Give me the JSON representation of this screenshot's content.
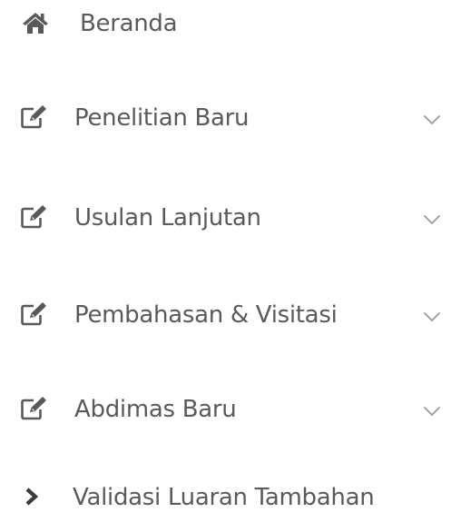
{
  "sidebar": {
    "text_color": "#5a5a5a",
    "icon_color": "#595959",
    "chevron_color": "#9a9a9a",
    "items": [
      {
        "label": "Beranda",
        "icon": "home-icon",
        "has_submenu": false
      },
      {
        "label": "Penelitian Baru",
        "icon": "edit-icon",
        "has_submenu": true
      },
      {
        "label": "Usulan Lanjutan",
        "icon": "edit-icon",
        "has_submenu": true
      },
      {
        "label": "Pembahasan & Visitasi",
        "icon": "edit-icon",
        "has_submenu": true
      },
      {
        "label": "Abdimas Baru",
        "icon": "edit-icon",
        "has_submenu": true
      },
      {
        "label": "Validasi Luaran Tambahan",
        "icon": "chevron-right-icon",
        "has_submenu": false
      }
    ]
  }
}
